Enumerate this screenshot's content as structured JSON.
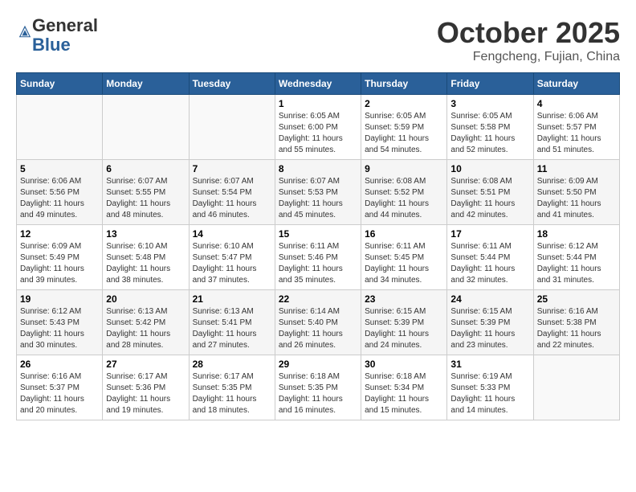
{
  "header": {
    "logo_general": "General",
    "logo_blue": "Blue",
    "month_title": "October 2025",
    "location": "Fengcheng, Fujian, China"
  },
  "days_of_week": [
    "Sunday",
    "Monday",
    "Tuesday",
    "Wednesday",
    "Thursday",
    "Friday",
    "Saturday"
  ],
  "weeks": [
    [
      {
        "day": "",
        "info": ""
      },
      {
        "day": "",
        "info": ""
      },
      {
        "day": "",
        "info": ""
      },
      {
        "day": "1",
        "info": "Sunrise: 6:05 AM\nSunset: 6:00 PM\nDaylight: 11 hours\nand 55 minutes."
      },
      {
        "day": "2",
        "info": "Sunrise: 6:05 AM\nSunset: 5:59 PM\nDaylight: 11 hours\nand 54 minutes."
      },
      {
        "day": "3",
        "info": "Sunrise: 6:05 AM\nSunset: 5:58 PM\nDaylight: 11 hours\nand 52 minutes."
      },
      {
        "day": "4",
        "info": "Sunrise: 6:06 AM\nSunset: 5:57 PM\nDaylight: 11 hours\nand 51 minutes."
      }
    ],
    [
      {
        "day": "5",
        "info": "Sunrise: 6:06 AM\nSunset: 5:56 PM\nDaylight: 11 hours\nand 49 minutes."
      },
      {
        "day": "6",
        "info": "Sunrise: 6:07 AM\nSunset: 5:55 PM\nDaylight: 11 hours\nand 48 minutes."
      },
      {
        "day": "7",
        "info": "Sunrise: 6:07 AM\nSunset: 5:54 PM\nDaylight: 11 hours\nand 46 minutes."
      },
      {
        "day": "8",
        "info": "Sunrise: 6:07 AM\nSunset: 5:53 PM\nDaylight: 11 hours\nand 45 minutes."
      },
      {
        "day": "9",
        "info": "Sunrise: 6:08 AM\nSunset: 5:52 PM\nDaylight: 11 hours\nand 44 minutes."
      },
      {
        "day": "10",
        "info": "Sunrise: 6:08 AM\nSunset: 5:51 PM\nDaylight: 11 hours\nand 42 minutes."
      },
      {
        "day": "11",
        "info": "Sunrise: 6:09 AM\nSunset: 5:50 PM\nDaylight: 11 hours\nand 41 minutes."
      }
    ],
    [
      {
        "day": "12",
        "info": "Sunrise: 6:09 AM\nSunset: 5:49 PM\nDaylight: 11 hours\nand 39 minutes."
      },
      {
        "day": "13",
        "info": "Sunrise: 6:10 AM\nSunset: 5:48 PM\nDaylight: 11 hours\nand 38 minutes."
      },
      {
        "day": "14",
        "info": "Sunrise: 6:10 AM\nSunset: 5:47 PM\nDaylight: 11 hours\nand 37 minutes."
      },
      {
        "day": "15",
        "info": "Sunrise: 6:11 AM\nSunset: 5:46 PM\nDaylight: 11 hours\nand 35 minutes."
      },
      {
        "day": "16",
        "info": "Sunrise: 6:11 AM\nSunset: 5:45 PM\nDaylight: 11 hours\nand 34 minutes."
      },
      {
        "day": "17",
        "info": "Sunrise: 6:11 AM\nSunset: 5:44 PM\nDaylight: 11 hours\nand 32 minutes."
      },
      {
        "day": "18",
        "info": "Sunrise: 6:12 AM\nSunset: 5:44 PM\nDaylight: 11 hours\nand 31 minutes."
      }
    ],
    [
      {
        "day": "19",
        "info": "Sunrise: 6:12 AM\nSunset: 5:43 PM\nDaylight: 11 hours\nand 30 minutes."
      },
      {
        "day": "20",
        "info": "Sunrise: 6:13 AM\nSunset: 5:42 PM\nDaylight: 11 hours\nand 28 minutes."
      },
      {
        "day": "21",
        "info": "Sunrise: 6:13 AM\nSunset: 5:41 PM\nDaylight: 11 hours\nand 27 minutes."
      },
      {
        "day": "22",
        "info": "Sunrise: 6:14 AM\nSunset: 5:40 PM\nDaylight: 11 hours\nand 26 minutes."
      },
      {
        "day": "23",
        "info": "Sunrise: 6:15 AM\nSunset: 5:39 PM\nDaylight: 11 hours\nand 24 minutes."
      },
      {
        "day": "24",
        "info": "Sunrise: 6:15 AM\nSunset: 5:39 PM\nDaylight: 11 hours\nand 23 minutes."
      },
      {
        "day": "25",
        "info": "Sunrise: 6:16 AM\nSunset: 5:38 PM\nDaylight: 11 hours\nand 22 minutes."
      }
    ],
    [
      {
        "day": "26",
        "info": "Sunrise: 6:16 AM\nSunset: 5:37 PM\nDaylight: 11 hours\nand 20 minutes."
      },
      {
        "day": "27",
        "info": "Sunrise: 6:17 AM\nSunset: 5:36 PM\nDaylight: 11 hours\nand 19 minutes."
      },
      {
        "day": "28",
        "info": "Sunrise: 6:17 AM\nSunset: 5:35 PM\nDaylight: 11 hours\nand 18 minutes."
      },
      {
        "day": "29",
        "info": "Sunrise: 6:18 AM\nSunset: 5:35 PM\nDaylight: 11 hours\nand 16 minutes."
      },
      {
        "day": "30",
        "info": "Sunrise: 6:18 AM\nSunset: 5:34 PM\nDaylight: 11 hours\nand 15 minutes."
      },
      {
        "day": "31",
        "info": "Sunrise: 6:19 AM\nSunset: 5:33 PM\nDaylight: 11 hours\nand 14 minutes."
      },
      {
        "day": "",
        "info": ""
      }
    ]
  ]
}
